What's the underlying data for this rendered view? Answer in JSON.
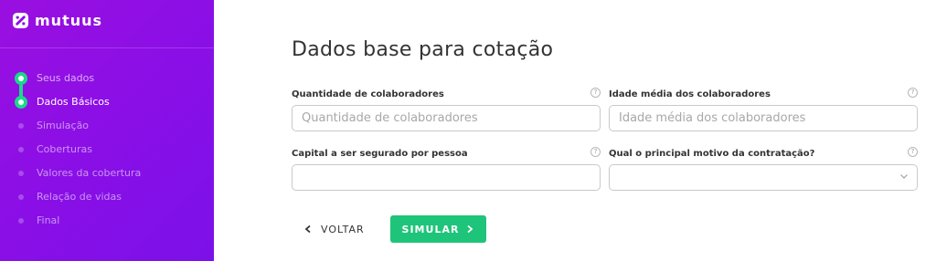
{
  "brand": {
    "name": "mutuus",
    "accent": "#19d98a",
    "sidebar_color": "#8a0fe6",
    "button_color": "#1ec47a"
  },
  "sidebar": {
    "steps": [
      {
        "label": "Seus dados",
        "state": "done"
      },
      {
        "label": "Dados Básicos",
        "state": "active"
      },
      {
        "label": "Simulação",
        "state": "pending"
      },
      {
        "label": "Coberturas",
        "state": "pending"
      },
      {
        "label": "Valores da cobertura",
        "state": "pending"
      },
      {
        "label": "Relação de vidas",
        "state": "pending"
      },
      {
        "label": "Final",
        "state": "pending"
      }
    ]
  },
  "main": {
    "title": "Dados base para cotação",
    "fields": {
      "quantity": {
        "label": "Quantidade de colaboradores",
        "placeholder": "Quantidade de colaboradores",
        "value": ""
      },
      "avg_age": {
        "label": "Idade média dos colaboradores",
        "placeholder": "Idade média dos colaboradores",
        "value": ""
      },
      "capital": {
        "label": "Capital a ser segurado por pessoa",
        "placeholder": "",
        "value": ""
      },
      "motive": {
        "label": "Qual o principal motivo da contratação?",
        "selected": ""
      }
    },
    "help_glyph": "?",
    "buttons": {
      "back": "VOLTAR",
      "next": "SIMULAR"
    }
  }
}
